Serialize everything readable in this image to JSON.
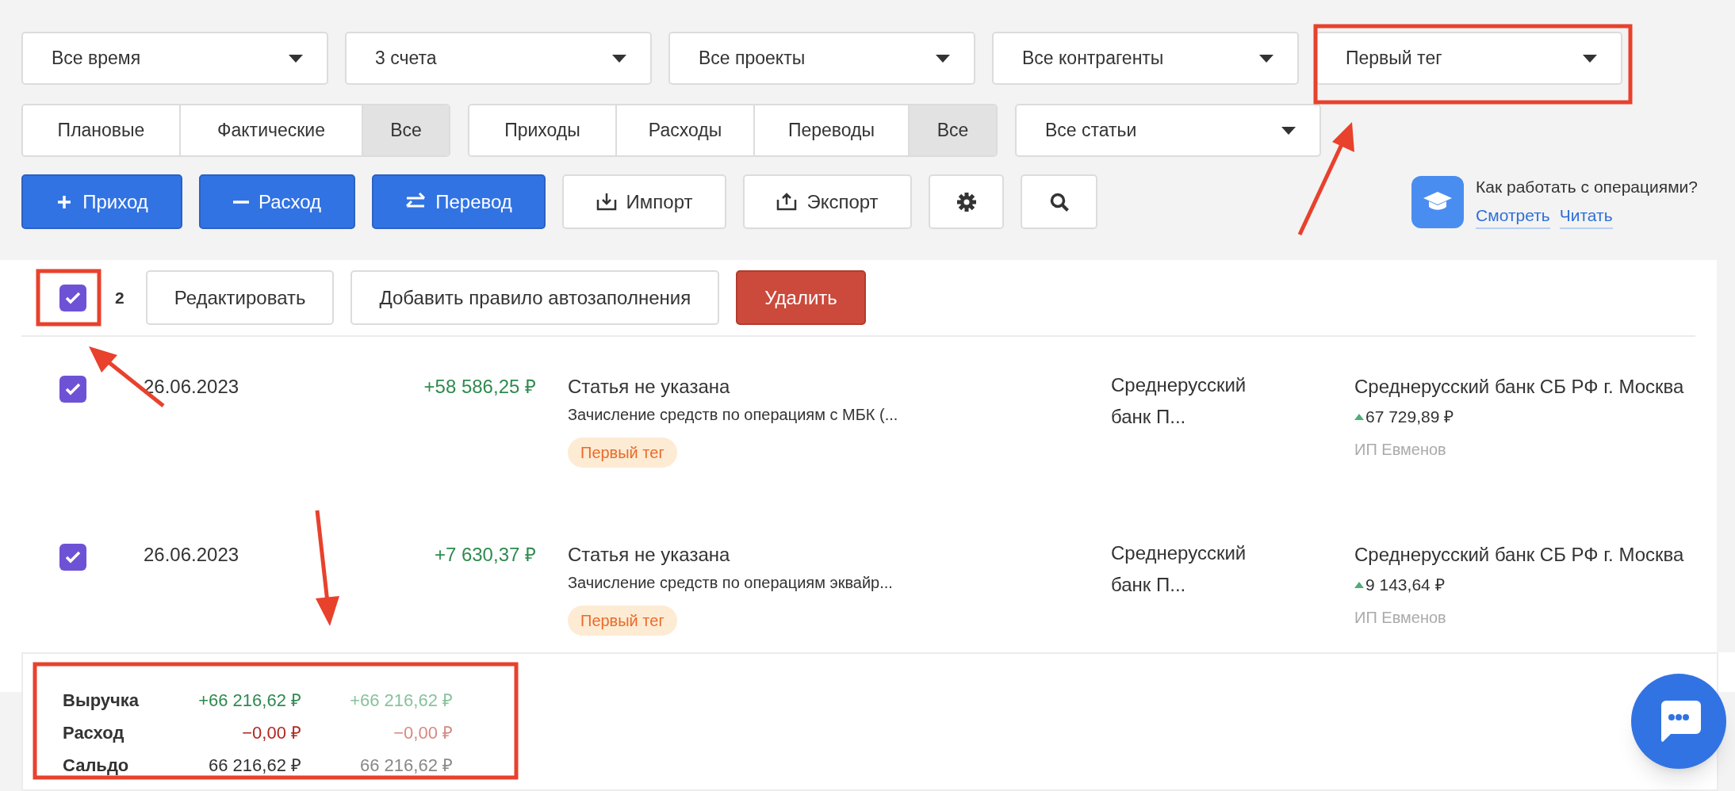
{
  "filters": {
    "dropdowns": [
      {
        "label": "Все время"
      },
      {
        "label": "3 счета"
      },
      {
        "label": "Все проекты"
      },
      {
        "label": "Все контрагенты"
      },
      {
        "label": "Первый тег"
      }
    ],
    "status_segments": [
      {
        "label": "Плановые",
        "selected": false
      },
      {
        "label": "Фактические",
        "selected": false
      },
      {
        "label": "Все",
        "selected": true
      }
    ],
    "type_segments": [
      {
        "label": "Приходы",
        "selected": false
      },
      {
        "label": "Расходы",
        "selected": false
      },
      {
        "label": "Переводы",
        "selected": false
      },
      {
        "label": "Все",
        "selected": true
      }
    ],
    "article_dropdown": {
      "label": "Все статьи"
    }
  },
  "actions": [
    {
      "kind": "income",
      "label": "Приход"
    },
    {
      "kind": "expense",
      "label": "Расход"
    },
    {
      "kind": "transfer",
      "label": "Перевод"
    },
    {
      "kind": "import",
      "label": "Импорт"
    },
    {
      "kind": "export",
      "label": "Экспорт"
    },
    {
      "kind": "settings"
    },
    {
      "kind": "search"
    }
  ],
  "help": {
    "question": "Как работать с операциями?",
    "links": [
      "Смотреть",
      "Читать"
    ]
  },
  "selection": {
    "checked": true,
    "count": "2",
    "buttons": [
      {
        "kind": "outline",
        "label": "Редактировать"
      },
      {
        "kind": "outline",
        "label": "Добавить правило автозаполнения"
      },
      {
        "kind": "danger",
        "label": "Удалить"
      }
    ]
  },
  "rows": [
    {
      "checked": true,
      "date": "26.06.2023",
      "amount": "+58 586,25 ₽",
      "article": "Статья не указана",
      "description": "Зачисление средств по операциям с МБК (...",
      "tag": "Первый тег",
      "counterparty": "Среднерусский банк П...",
      "account": "Среднерусский банк СБ РФ г. Москва",
      "balance": "67 729,89 ₽",
      "owner": "ИП Евменов"
    },
    {
      "checked": true,
      "date": "26.06.2023",
      "amount": "+7 630,37 ₽",
      "article": "Статья не указана",
      "description": "Зачисление средств по операциям эквайр...",
      "tag": "Первый тег",
      "counterparty": "Среднерусский банк П...",
      "account": "Среднерусский банк СБ РФ г. Москва",
      "balance": "9 143,64 ₽",
      "owner": "ИП Евменов"
    }
  ],
  "totals": [
    {
      "kind": "income",
      "label": "Выручка",
      "value": "+66 216,62 ₽",
      "value_2": "+66 216,62 ₽"
    },
    {
      "kind": "expense",
      "label": "Расход",
      "value": "−0,00 ₽",
      "value_2": "−0,00 ₽"
    },
    {
      "kind": "balance",
      "label": "Сальдо",
      "value": "66 216,62 ₽",
      "value_2": "66 216,62 ₽"
    }
  ]
}
